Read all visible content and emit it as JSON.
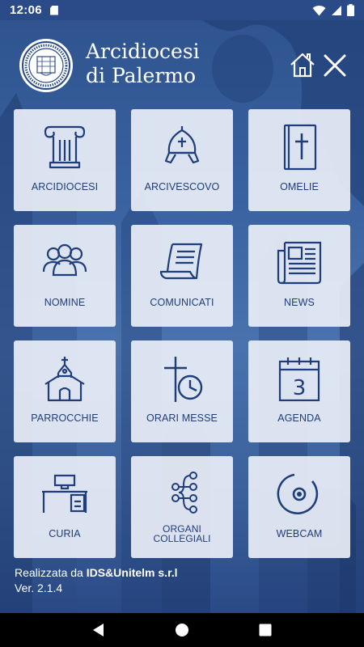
{
  "status_bar": {
    "time": "12:06"
  },
  "header": {
    "title_line1": "Arcidiocesi",
    "title_line2": "di Palermo"
  },
  "tiles": [
    {
      "label": "ARCIDIOCESI",
      "icon": "column-icon"
    },
    {
      "label": "ARCIVESCOVO",
      "icon": "mitre-icon"
    },
    {
      "label": "OMELIE",
      "icon": "bible-icon"
    },
    {
      "label": "NOMINE",
      "icon": "people-icon"
    },
    {
      "label": "COMUNICATI",
      "icon": "scroll-icon"
    },
    {
      "label": "NEWS",
      "icon": "newspaper-icon"
    },
    {
      "label": "PARROCCHIE",
      "icon": "church-icon"
    },
    {
      "label": "ORARI MESSE",
      "icon": "cross-clock-icon"
    },
    {
      "label": "AGENDA",
      "icon": "calendar-icon"
    },
    {
      "label": "CURIA",
      "icon": "desk-icon"
    },
    {
      "label_line1": "ORGANI",
      "label_line2": "COLLEGIALI",
      "icon": "share-nodes-icon"
    },
    {
      "label": "WEBCAM",
      "icon": "webcam-icon"
    }
  ],
  "agenda_day": "3",
  "footer": {
    "prefix": "Realizzata da ",
    "company": "IDS&Unitelm s.r.l",
    "version": "Ver. 2.1.4"
  },
  "colors": {
    "accent": "#1f3d7a",
    "status_bar": "#2a4a88",
    "tile_bg": "#eef2f9"
  }
}
